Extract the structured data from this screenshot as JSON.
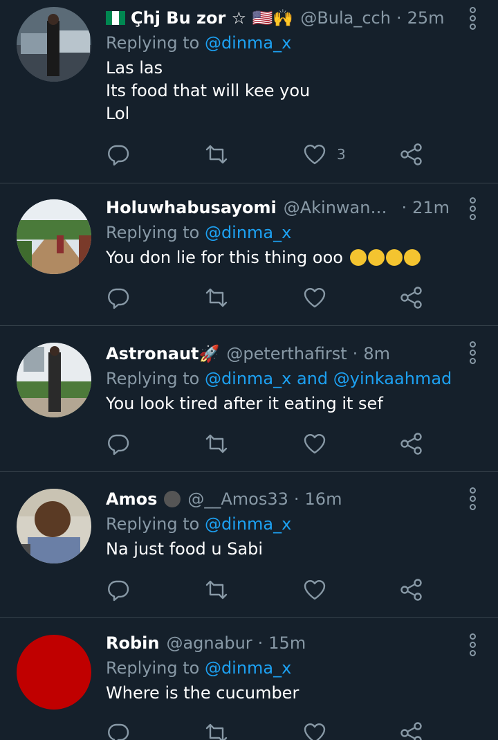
{
  "tweets": [
    {
      "name": "Çhj Bu zor ☆ 🇺🇸🙌",
      "handle": "@Bula_cch",
      "time": "25m",
      "replying_prefix": "Replying to ",
      "mentions": "@dinma_x",
      "body": "Las las\nIts food that will kee you\nLol",
      "like_count": "3",
      "has_flag": true
    },
    {
      "name": "Holuwhabusayomi",
      "handle": "@Akinwandehol...",
      "time": "21m",
      "replying_prefix": "Replying to ",
      "mentions": "@dinma_x",
      "body": "You don lie for this thing ooo",
      "like_count": ""
    },
    {
      "name": "Astronaut🚀",
      "handle": "@peterthafirst",
      "time": "8m",
      "replying_prefix": "Replying to ",
      "mentions": "@dinma_x and @yinkaahmad",
      "body": "You look tired after it eating it sef",
      "like_count": ""
    },
    {
      "name": "Amos",
      "handle": "@__Amos33",
      "time": "16m",
      "replying_prefix": "Replying to ",
      "mentions": "@dinma_x",
      "body": "Na just food u Sabi",
      "like_count": ""
    },
    {
      "name": "Robin",
      "handle": "@agnabur",
      "time": "15m",
      "replying_prefix": "Replying to ",
      "mentions": "@dinma_x",
      "body": "Where is the cucumber",
      "like_count": ""
    }
  ],
  "time_separator": "·",
  "icons": {
    "reply": "reply-icon",
    "retweet": "retweet-icon",
    "like": "heart-icon",
    "share": "share-icon",
    "more": "more-options-icon"
  },
  "colors": {
    "background": "#15202b",
    "divider": "#38444d",
    "secondary_text": "#8899a6",
    "link": "#1da1f2",
    "robin_avatar": "#c00000"
  }
}
